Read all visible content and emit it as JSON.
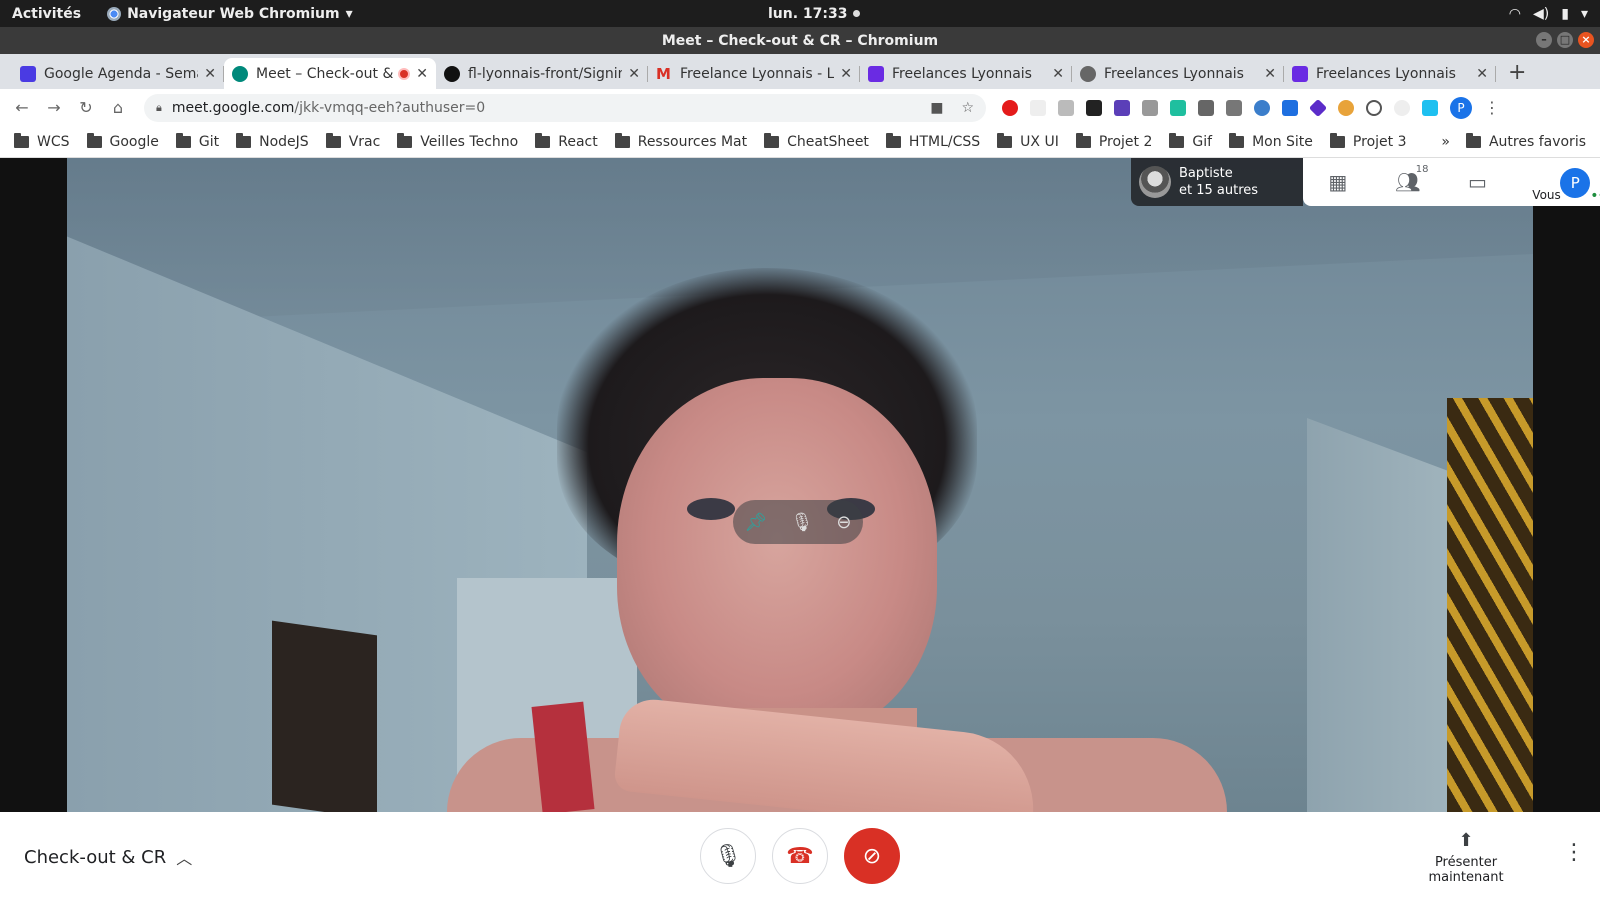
{
  "system": {
    "activities": "Activités",
    "app_name": "Navigateur Web Chromium",
    "clock": "lun. 17:33"
  },
  "window": {
    "title": "Meet – Check-out & CR – Chromium"
  },
  "tabs": [
    {
      "title": "Google Agenda - Semaine",
      "favicon": "calendar-icon",
      "color": "#4a3be3"
    },
    {
      "title": "Meet – Check-out & CR",
      "favicon": "meet-icon",
      "color": "#00897b",
      "active": true
    },
    {
      "title": "fl-lyonnais-front/Signin",
      "favicon": "github-icon",
      "color": "#111111"
    },
    {
      "title": "Freelance Lyonnais - Le",
      "favicon": "gmail-icon",
      "color": "#d93025"
    },
    {
      "title": "Freelances Lyonnais",
      "favicon": "site-icon",
      "color": "#6a2be3"
    },
    {
      "title": "Freelances Lyonnais",
      "favicon": "globe-icon",
      "color": "#666666"
    },
    {
      "title": "Freelances Lyonnais",
      "favicon": "site-icon",
      "color": "#6a2be3"
    }
  ],
  "address": {
    "host": "meet.google.com",
    "path": "/jkk-vmqq-eeh?authuser=0"
  },
  "profile_initial": "P",
  "bookmarks": [
    "WCS",
    "Google",
    "Git",
    "NodeJS",
    "Vrac",
    "Veilles Techno",
    "React",
    "Ressources Mat",
    "CheatSheet",
    "HTML/CSS",
    "UX UI",
    "Projet 2",
    "Gif",
    "Mon Site",
    "Projet 3"
  ],
  "bookmarks_more": "»",
  "bookmarks_other": "Autres favoris",
  "meet": {
    "participant_name": "Baptiste",
    "participant_others": "et 15 autres",
    "participant_count": "18",
    "you_label": "Vous",
    "you_initial": "P",
    "meeting_title": "Check-out & CR",
    "present_label": "Présenter maintenant"
  }
}
